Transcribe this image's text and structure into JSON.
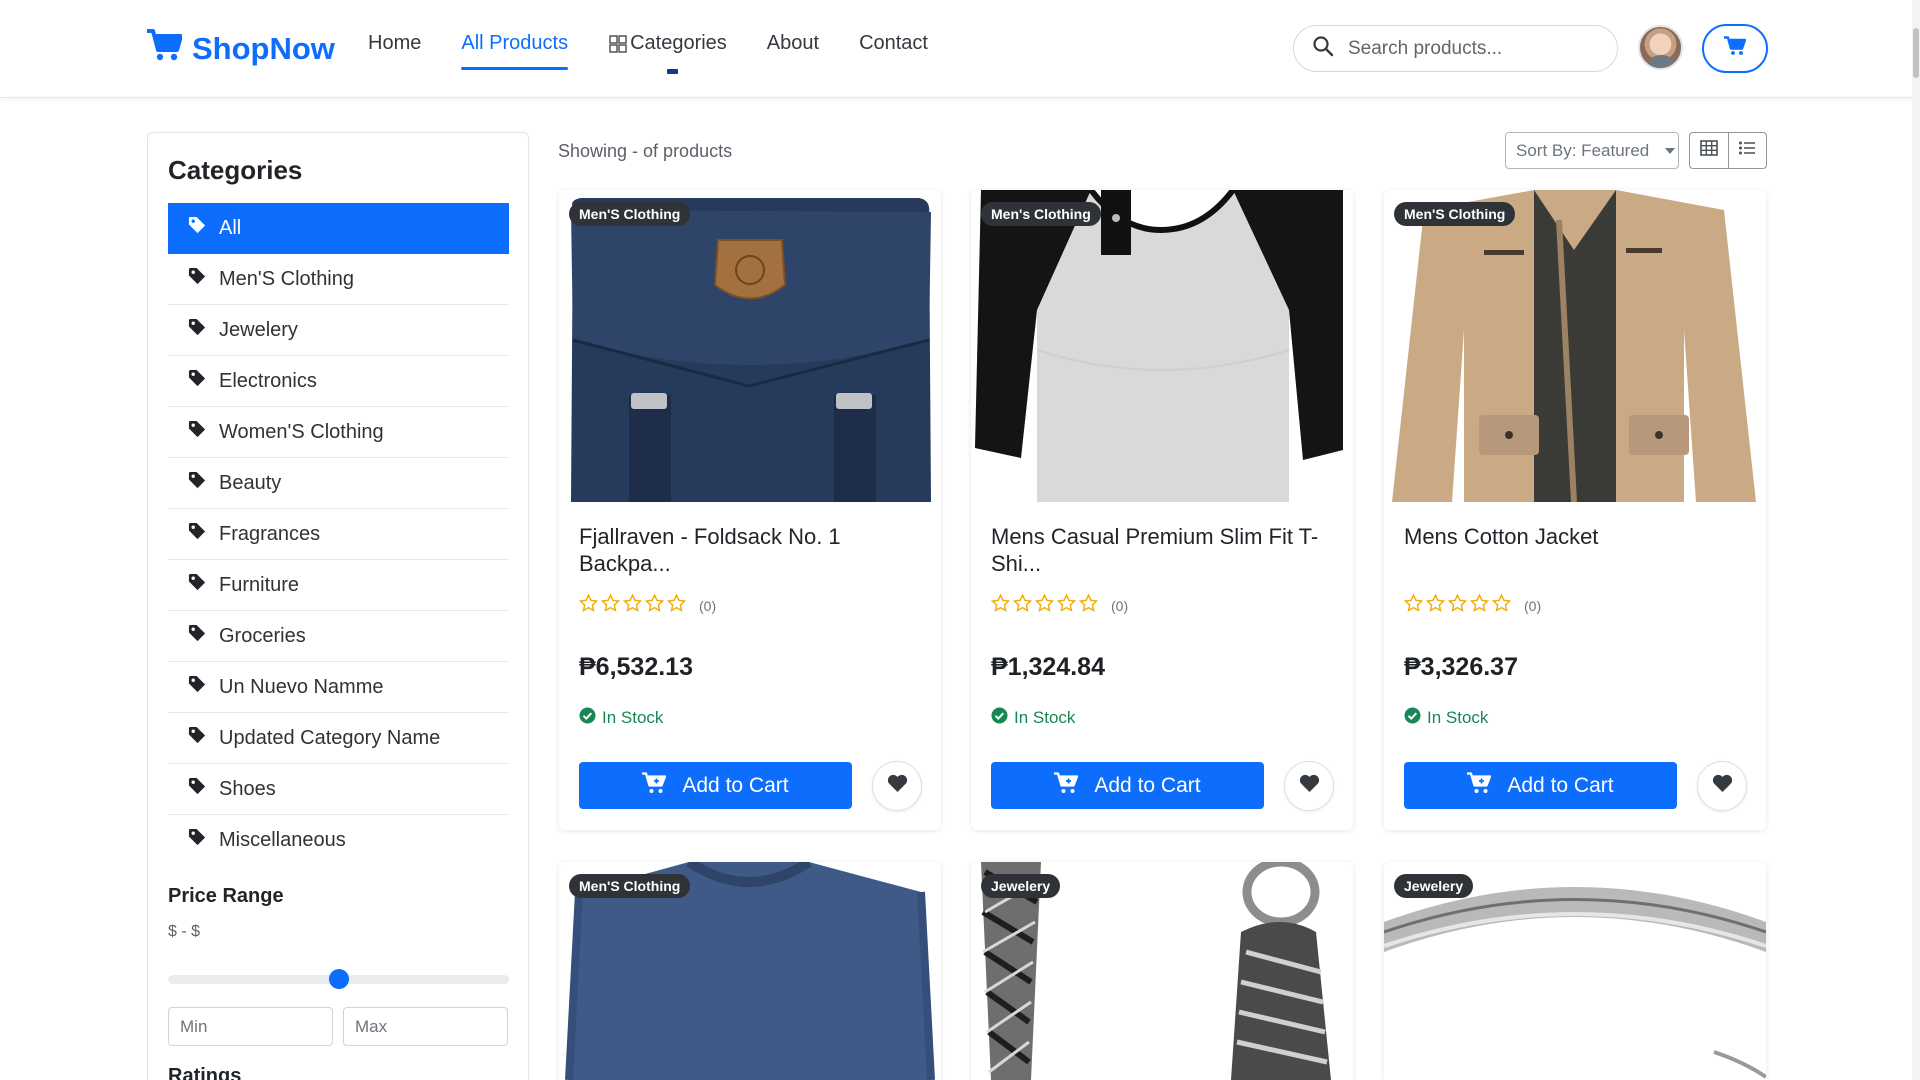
{
  "app": {
    "brand": "ShopNow",
    "brand_color": "#0d6efd"
  },
  "nav": {
    "links": [
      "Home",
      "All Products",
      "Categories",
      "About",
      "Contact"
    ],
    "active": "All Products"
  },
  "search": {
    "placeholder": "Search products..."
  },
  "sidebar": {
    "title": "Categories",
    "categories": [
      "All",
      "Men'S Clothing",
      "Jewelery",
      "Electronics",
      "Women'S Clothing",
      "Beauty",
      "Fragrances",
      "Furniture",
      "Groceries",
      "Un Nuevo Namme",
      "Updated Category Name",
      "Shoes",
      "Miscellaneous"
    ],
    "active_category": "All",
    "price": {
      "title": "Price Range",
      "range_text": "$ - $",
      "min_placeholder": "Min",
      "max_placeholder": "Max",
      "slider_fraction": 0.5
    },
    "ratings_title": "Ratings"
  },
  "toolbar": {
    "showing": "Showing - of products",
    "sort_label": "Sort By: Featured"
  },
  "products": [
    {
      "badge": "Men'S Clothing",
      "title_line1": "Fjallraven - Foldsack No. 1",
      "title_line2": "Backpa...",
      "rating_count": "(0)",
      "price": "₱6,532.13",
      "stock": "In Stock",
      "add_label": "Add to Cart",
      "image": "backpack"
    },
    {
      "badge": "Men's Clothing",
      "title_line1": "Mens Casual Premium Slim Fit T-",
      "title_line2": "Shi...",
      "rating_count": "(0)",
      "price": "₱1,324.84",
      "stock": "In Stock",
      "add_label": "Add to Cart",
      "image": "raglan-tshirt"
    },
    {
      "badge": "Men'S Clothing",
      "title_line1": "Mens Cotton Jacket",
      "title_line2": "",
      "rating_count": "(0)",
      "price": "₱3,326.37",
      "stock": "In Stock",
      "add_label": "Add to Cart",
      "image": "jacket"
    },
    {
      "badge": "Men'S Clothing",
      "image": "long-sleeve-shirt"
    },
    {
      "badge": "Jewelery",
      "image": "chain-bracelet"
    },
    {
      "badge": "Jewelery",
      "image": "silver-ring"
    }
  ]
}
